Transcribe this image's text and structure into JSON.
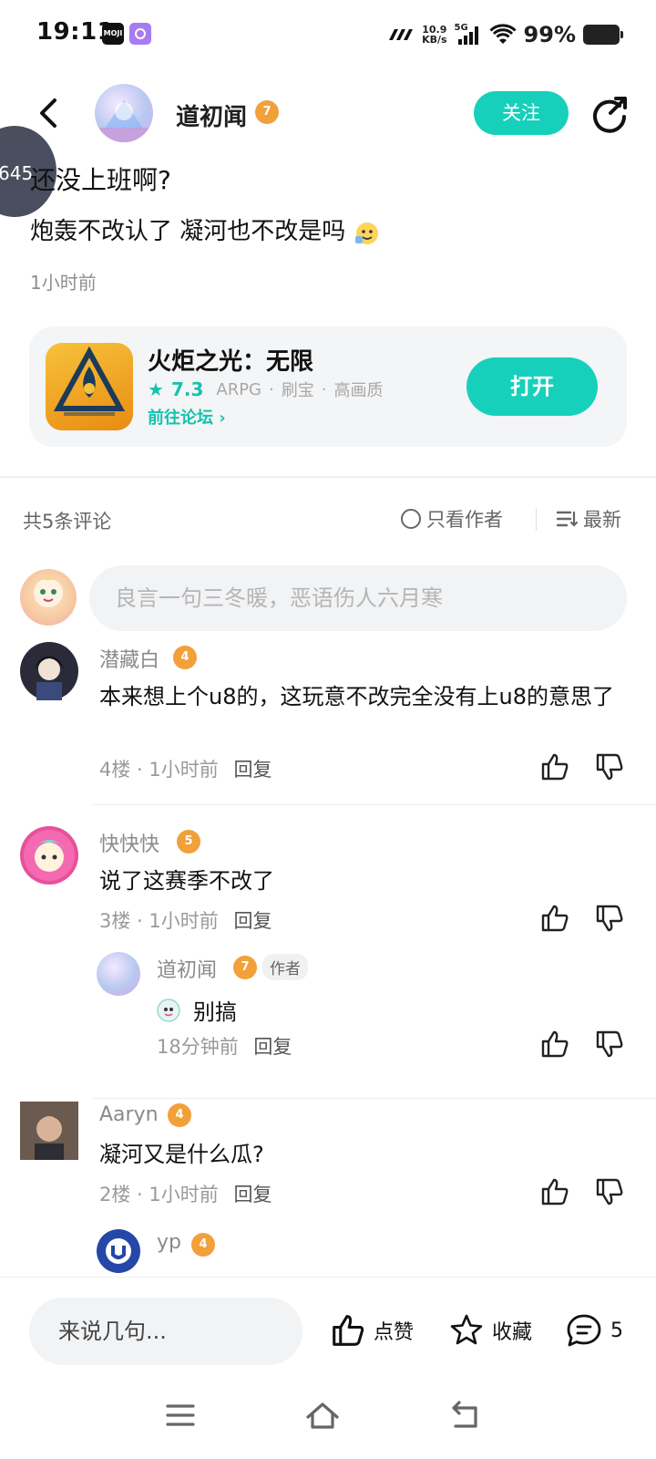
{
  "status_bar": {
    "time": "19:11",
    "moji_label": "MOJI",
    "speed_value": "10.9",
    "speed_unit": "KB/s",
    "network": "5G",
    "battery": "99%"
  },
  "header": {
    "author_name": "道初闻",
    "author_level": "7",
    "follow_label": "关注"
  },
  "floating_bubble": "645",
  "post": {
    "title": "还没上班啊?",
    "body": "炮轰不改认了  凝河也不改是吗",
    "time": "1小时前"
  },
  "game_card": {
    "title": "火炬之光：无限",
    "score": "7.3",
    "tags": [
      "ARPG",
      "刷宝",
      "高画质"
    ],
    "forum_link": "前往论坛",
    "open_label": "打开"
  },
  "comments_header": {
    "count": "共5条评论",
    "only_author": "只看作者",
    "sort": "最新"
  },
  "comment_input_placeholder": "良言一句三冬暖，恶语伤人六月寒",
  "comments": [
    {
      "name": "潜藏白",
      "level": "4",
      "text": "本来想上个u8的，这玩意不改完全没有上u8的意思了",
      "floor": "4楼",
      "time": "1小时前",
      "reply": "回复"
    },
    {
      "name": "快快快",
      "level": "5",
      "text": "说了这赛季不改了",
      "floor": "3楼",
      "time": "1小时前",
      "reply": "回复",
      "sub_reply": {
        "name": "道初闻",
        "level": "7",
        "tag": "作者",
        "text": "别搞",
        "time": "18分钟前",
        "reply": "回复"
      }
    },
    {
      "name": "Aaryn",
      "level": "4",
      "text": "凝河又是什么瓜?",
      "floor": "2楼",
      "time": "1小时前",
      "reply": "回复",
      "sub_reply": {
        "name": "yp",
        "level": "4"
      }
    }
  ],
  "bottom_bar": {
    "input_placeholder": "来说几句...",
    "like_label": "点赞",
    "fav_label": "收藏",
    "comment_count": "5"
  },
  "colors": {
    "accent": "#17d0bb",
    "level_badge": "#f2a03a"
  }
}
